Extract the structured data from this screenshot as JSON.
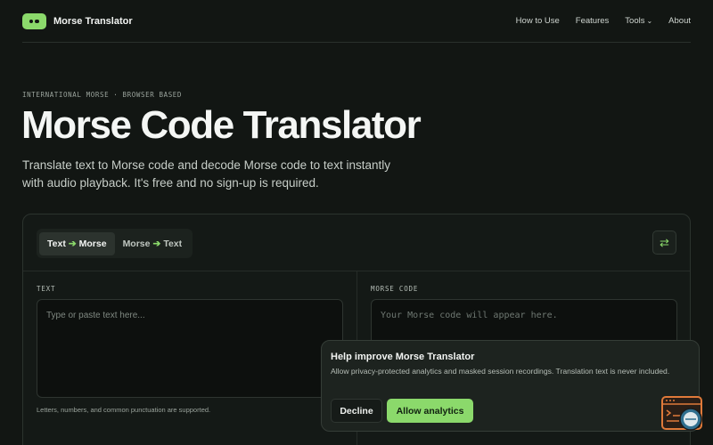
{
  "header": {
    "brand": "Morse Translator",
    "nav": [
      "How to Use",
      "Features",
      "Tools",
      "About"
    ]
  },
  "hero": {
    "eyebrow": "INTERNATIONAL MORSE · BROWSER BASED",
    "title": "Morse Code Translator",
    "subtitle": "Translate text to Morse code and decode Morse code to text instantly with audio playback. It's free and no sign-up is required."
  },
  "translator": {
    "tabs": [
      {
        "from": "Text",
        "to": "Morse",
        "active": true
      },
      {
        "from": "Morse",
        "to": "Text",
        "active": false
      }
    ],
    "swap_icon": "swap-arrows-icon",
    "text_label": "TEXT",
    "text_placeholder": "Type or paste text here...",
    "text_hint": "Letters, numbers, and common punctuation are supported.",
    "morse_label": "MORSE CODE",
    "morse_placeholder": "Your Morse code will appear here."
  },
  "consent": {
    "title": "Help improve Morse Translator",
    "body": "Allow privacy-protected analytics and masked session recordings. Translation text is never included.",
    "decline": "Decline",
    "allow": "Allow analytics"
  },
  "colors": {
    "accent": "#8bd96b",
    "background": "#121613",
    "widget": "#e07a3a"
  }
}
